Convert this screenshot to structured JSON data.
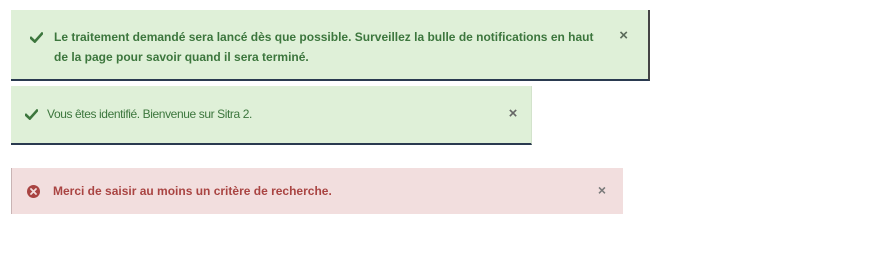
{
  "alerts": [
    {
      "type": "success",
      "icon": "check-icon",
      "message": "Le traitement demandé sera lancé dès que possible. Surveillez la bulle de notifications en haut de la page pour savoir quand il sera terminé.",
      "close_label": "×"
    },
    {
      "type": "success",
      "icon": "check-icon",
      "message": "Vous êtes identifié. Bienvenue sur Sitra 2.",
      "close_label": "×"
    },
    {
      "type": "danger",
      "icon": "error-circle-icon",
      "message": "Merci de saisir au moins un critère de recherche.",
      "close_label": "×"
    }
  ],
  "colors": {
    "success_bg": "#dff0d8",
    "success_text": "#3c763d",
    "danger_bg": "#f2dede",
    "danger_text": "#a94442"
  }
}
